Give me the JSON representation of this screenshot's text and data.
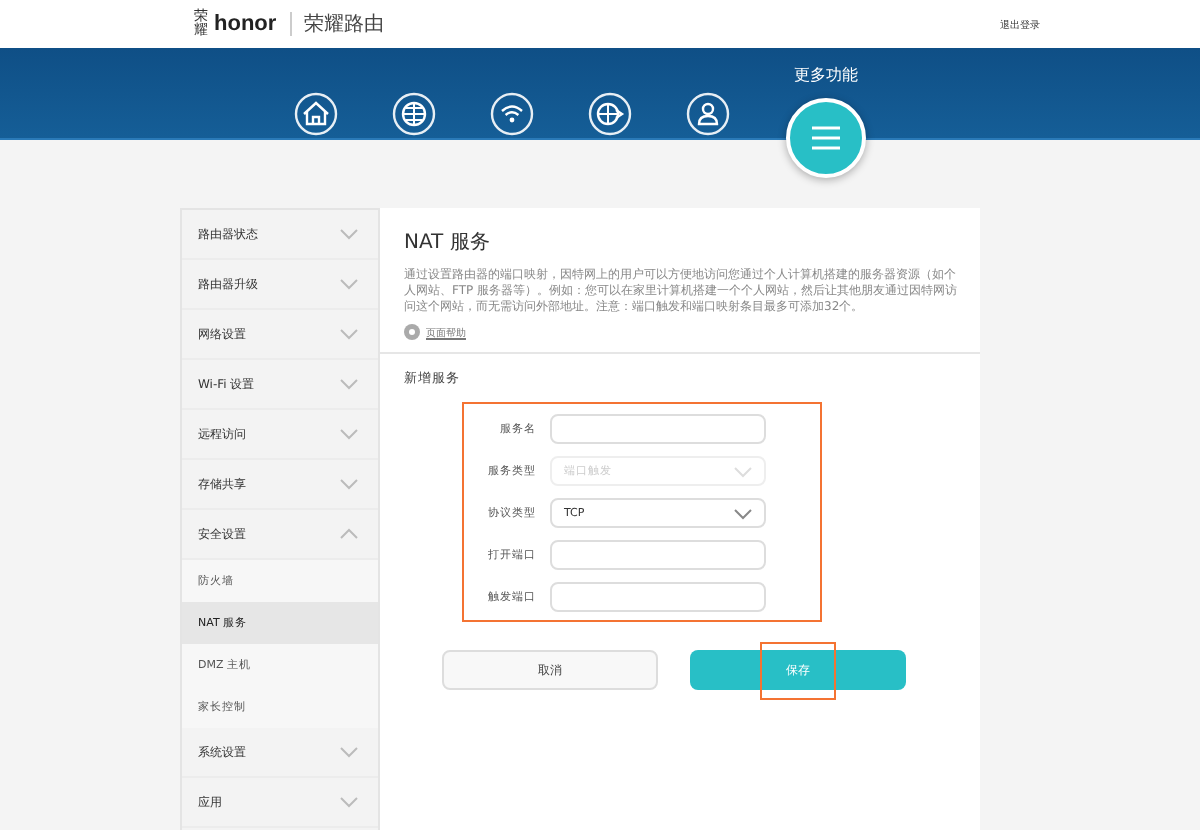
{
  "header": {
    "brand_mark": "荣耀",
    "logo": "honor",
    "product": "荣耀路由",
    "logout": "退出登录"
  },
  "nav": {
    "more_label": "更多功能",
    "icons": [
      {
        "kind": "home"
      },
      {
        "kind": "globe"
      },
      {
        "kind": "wifi"
      },
      {
        "kind": "globe-arrow"
      },
      {
        "kind": "user"
      }
    ]
  },
  "sidebar": {
    "items": [
      {
        "label": "路由器状态",
        "expanded": false
      },
      {
        "label": "路由器升级",
        "expanded": false
      },
      {
        "label": "网络设置",
        "expanded": false
      },
      {
        "label": "Wi-Fi 设置",
        "expanded": false
      },
      {
        "label": "远程访问",
        "expanded": false
      },
      {
        "label": "存储共享",
        "expanded": false
      },
      {
        "label": "安全设置",
        "expanded": true,
        "children": [
          {
            "label": "防火墙",
            "selected": false
          },
          {
            "label": "NAT 服务",
            "selected": true
          },
          {
            "label": "DMZ 主机",
            "selected": false
          },
          {
            "label": "家长控制",
            "selected": false
          }
        ]
      },
      {
        "label": "系统设置",
        "expanded": false
      },
      {
        "label": "应用",
        "expanded": false
      }
    ]
  },
  "main": {
    "title": "NAT 服务",
    "description": "通过设置路由器的端口映射，因特网上的用户可以方便地访问您通过个人计算机搭建的服务器资源（如个人网站、FTP 服务器等）。例如：您可以在家里计算机搭建一个个人网站，然后让其他朋友通过因特网访问这个网站，而无需访问外部地址。注意：端口触发和端口映射条目最多可添加32个。",
    "help_link": "页面帮助",
    "section_title": "新增服务",
    "fields": [
      {
        "label": "服务名",
        "kind": "text",
        "disabled": false
      },
      {
        "label": "服务类型",
        "kind": "select",
        "value": "端口触发",
        "disabled": true
      },
      {
        "label": "协议类型",
        "kind": "select",
        "value": "TCP",
        "disabled": false
      },
      {
        "label": "打开端口",
        "kind": "text",
        "disabled": false
      },
      {
        "label": "触发端口",
        "kind": "text",
        "disabled": false
      }
    ],
    "buttons": [
      {
        "label": "取消",
        "kind": "secondary"
      },
      {
        "label": "保存",
        "kind": "primary",
        "highlighted": true
      }
    ]
  }
}
